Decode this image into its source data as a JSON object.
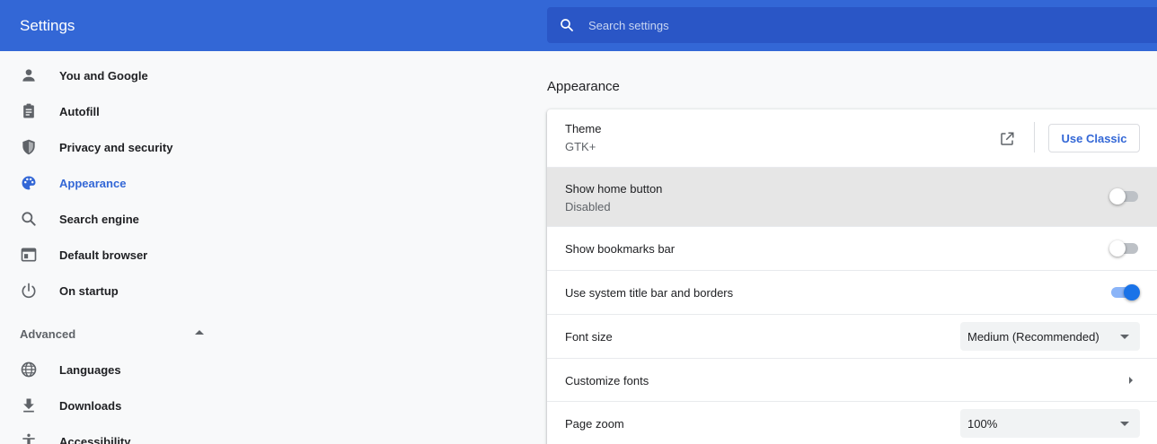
{
  "header": {
    "title": "Settings"
  },
  "search": {
    "placeholder": "Search settings"
  },
  "sidebar": {
    "items": [
      {
        "label": "You and Google",
        "icon": "person-icon"
      },
      {
        "label": "Autofill",
        "icon": "clipboard-icon"
      },
      {
        "label": "Privacy and security",
        "icon": "shield-icon"
      },
      {
        "label": "Appearance",
        "icon": "palette-icon",
        "active": true
      },
      {
        "label": "Search engine",
        "icon": "search-icon"
      },
      {
        "label": "Default browser",
        "icon": "browser-window-icon"
      },
      {
        "label": "On startup",
        "icon": "power-icon"
      }
    ],
    "advanced_label": "Advanced",
    "advanced_items": [
      {
        "label": "Languages",
        "icon": "globe-icon"
      },
      {
        "label": "Downloads",
        "icon": "download-icon"
      },
      {
        "label": "Accessibility",
        "icon": "accessibility-icon"
      }
    ]
  },
  "appearance": {
    "section_title": "Appearance",
    "theme": {
      "label": "Theme",
      "value": "GTK+",
      "button": "Use Classic"
    },
    "home_button": {
      "label": "Show home button",
      "status": "Disabled",
      "enabled": false
    },
    "bookmarks_bar": {
      "label": "Show bookmarks bar",
      "enabled": false
    },
    "system_title_bar": {
      "label": "Use system title bar and borders",
      "enabled": true
    },
    "font_size": {
      "label": "Font size",
      "value": "Medium (Recommended)"
    },
    "customize_fonts": {
      "label": "Customize fonts"
    },
    "page_zoom": {
      "label": "Page zoom",
      "value": "100%"
    }
  },
  "colors": {
    "header_bg": "#3367d6",
    "search_bg": "#2a56c6",
    "accent": "#3367d6",
    "toggle_on": "#1a73e8"
  }
}
